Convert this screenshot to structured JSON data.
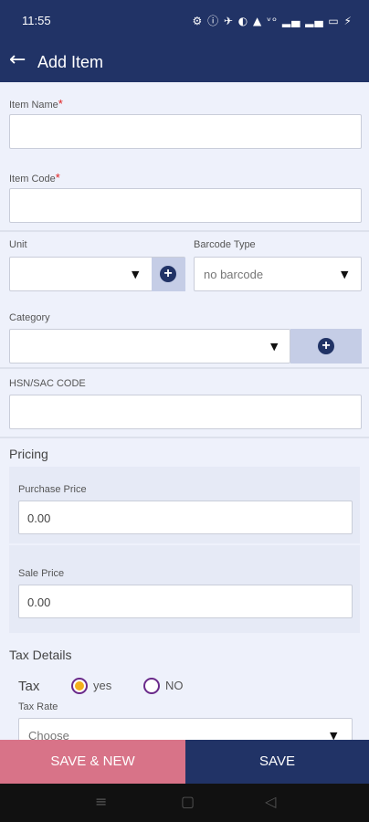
{
  "status": {
    "time": "11:55",
    "icons": "⚙ ⓘ ✈ ◐ ▲ ᵛᵒ ▂▄ ▂▄ ▭ ⚡"
  },
  "appbar": {
    "back_icon": "←",
    "title": "Add Item"
  },
  "form": {
    "item_name_label": "Item Name",
    "item_code_label": "Item Code",
    "required_mark": "*",
    "unit_label": "Unit",
    "barcode_type_label": "Barcode Type",
    "barcode_type_value": "no barcode",
    "category_label": "Category",
    "hsn_label": "HSN/SAC CODE"
  },
  "pricing": {
    "heading": "Pricing",
    "purchase_label": "Purchase Price",
    "purchase_value": "0.00",
    "sale_label": "Sale Price",
    "sale_value": "0.00"
  },
  "tax": {
    "heading": "Tax Details",
    "tax_label": "Tax",
    "yes_label": "yes",
    "no_label": "NO",
    "selected": "yes",
    "rate_label": "Tax Rate",
    "rate_placeholder": "Choose"
  },
  "actions": {
    "save_new": "SAVE & NEW",
    "save": "SAVE"
  },
  "nav": {
    "menu_icon": "≡",
    "home_icon": "▢",
    "back_icon": "◁"
  }
}
